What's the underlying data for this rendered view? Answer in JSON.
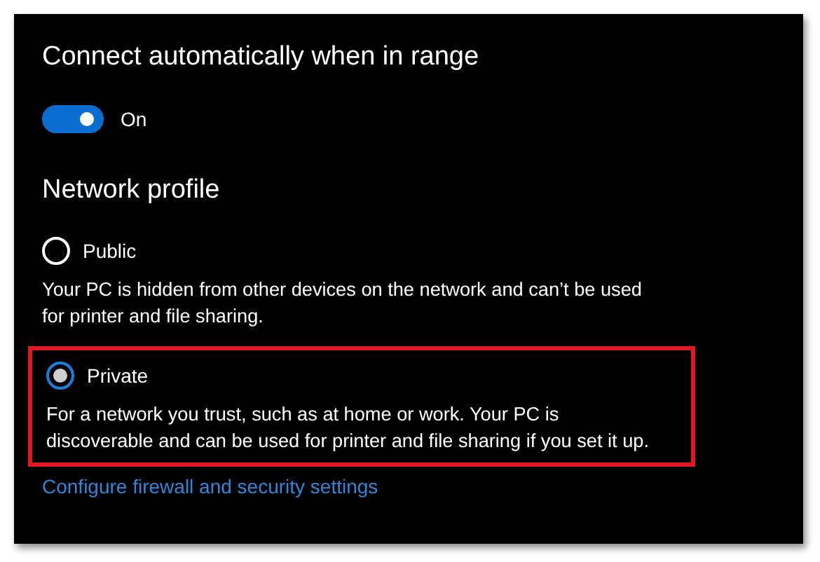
{
  "auto_connect": {
    "title": "Connect automatically when in range",
    "toggle": {
      "on": true,
      "label": "On"
    }
  },
  "network_profile": {
    "title": "Network profile",
    "options": [
      {
        "label": "Public",
        "selected": false,
        "highlighted": false,
        "description": "Your PC is hidden from other devices on the network and can’t be used for printer and file sharing."
      },
      {
        "label": "Private",
        "selected": true,
        "highlighted": true,
        "description": "For a network you trust, such as at home or work. Your PC is discoverable and can be used for printer and file sharing if you set it up."
      }
    ]
  },
  "link": "Configure firewall and security settings"
}
